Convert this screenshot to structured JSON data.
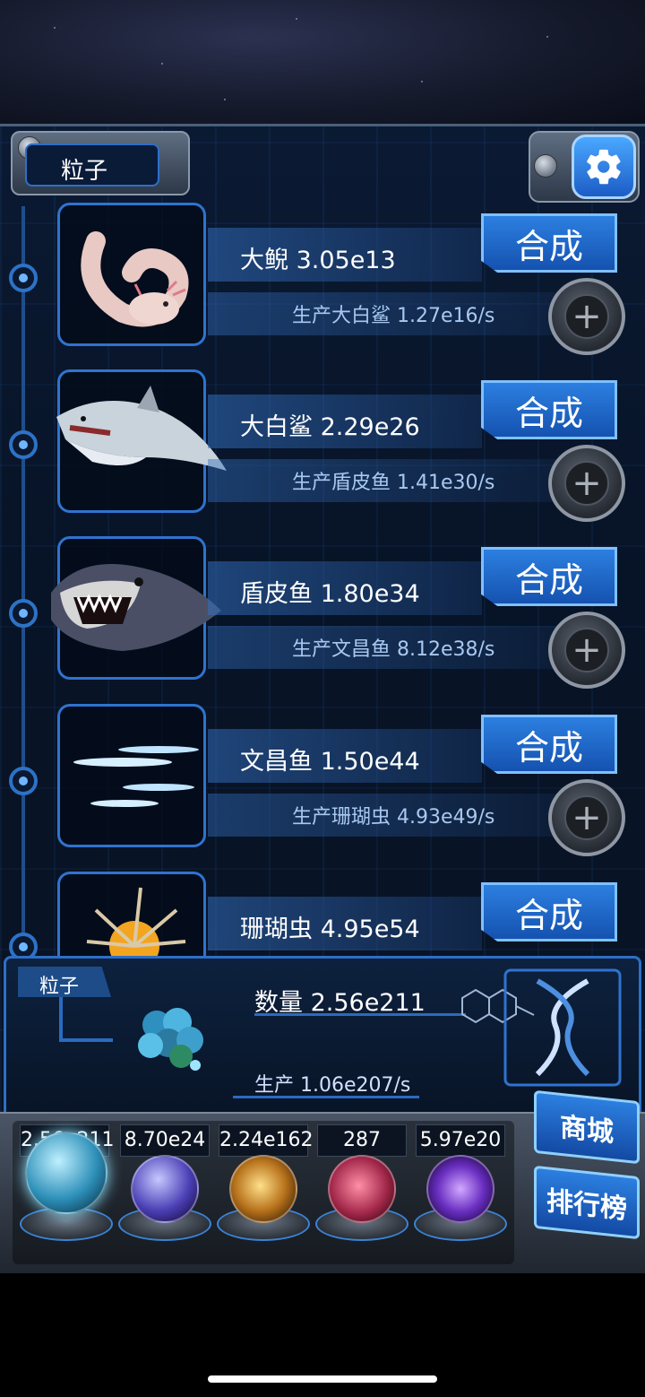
{
  "header": {
    "tab_label": "粒子"
  },
  "icons": {
    "settings": "gear-icon",
    "plus": "plus-icon"
  },
  "colors": {
    "accent": "#2f73cf",
    "button": "#2c7fe0",
    "panel_bg": "#071326"
  },
  "rows": [
    {
      "name": "大鲵 3.05e13",
      "production": "生产大白鲨 1.27e16/s",
      "combine_label": "合成",
      "creature": "axolotl"
    },
    {
      "name": "大白鲨 2.29e26",
      "production": "生产盾皮鱼 1.41e30/s",
      "combine_label": "合成",
      "creature": "great-white-shark"
    },
    {
      "name": "盾皮鱼 1.80e34",
      "production": "生产文昌鱼 8.12e38/s",
      "combine_label": "合成",
      "creature": "dunkleosteus"
    },
    {
      "name": "文昌鱼 1.50e44",
      "production": "生产珊瑚虫 4.93e49/s",
      "combine_label": "合成",
      "creature": "lancelet"
    },
    {
      "name": "珊瑚虫 4.95e54",
      "production": "",
      "combine_label": "合成",
      "creature": "coral-polyp"
    }
  ],
  "info": {
    "tab_label": "粒子",
    "quantity": "数量 2.56e211",
    "production": "生产 1.06e207/s"
  },
  "resources": [
    {
      "count": "2.56e211",
      "orb": "particle-orb"
    },
    {
      "count": "8.70e24",
      "orb": "lightning-orb"
    },
    {
      "count": "2.24e162",
      "orb": "galaxy-orb"
    },
    {
      "count": "287",
      "orb": "brain-orb"
    },
    {
      "count": "5.97e20",
      "orb": "vortex-orb"
    }
  ],
  "side_buttons": {
    "shop": "商城",
    "leaderboard": "排行榜"
  }
}
